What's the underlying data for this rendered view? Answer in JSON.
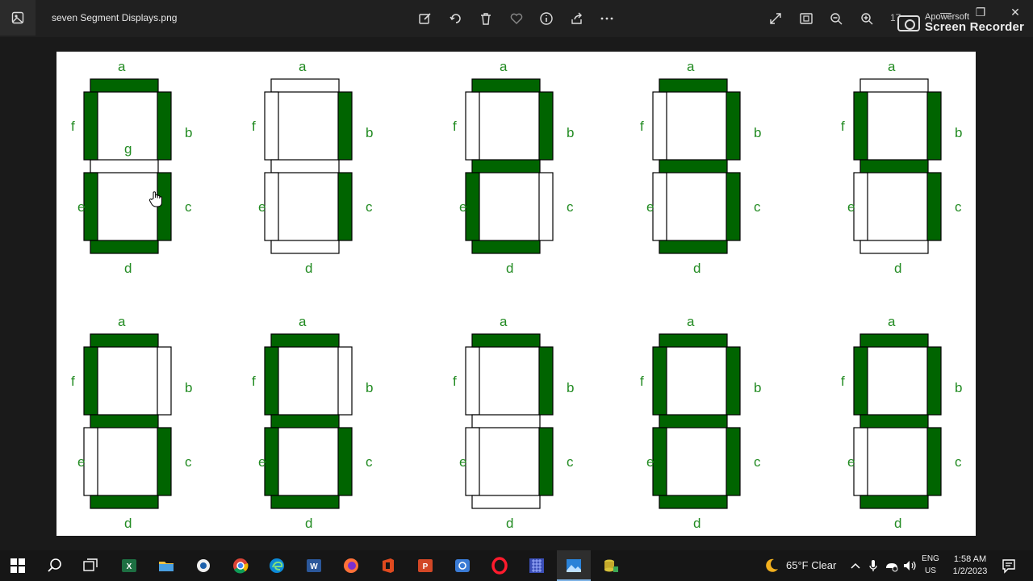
{
  "titlebar": {
    "file_name": "seven Segment Displays.png",
    "zoom_label": "17",
    "watermark_small": "Apowersoft",
    "watermark_big": "Screen Recorder",
    "toolbar_icons": [
      "edit-icon",
      "rotate-icon",
      "delete-icon",
      "favorite-icon",
      "info-icon",
      "share-icon",
      "more-icon"
    ],
    "right_icons": [
      "fullscreen-icon",
      "fit-window-icon",
      "zoom-out-icon",
      "zoom-in-icon"
    ],
    "window_controls": {
      "minimize": "—",
      "restore": "❐",
      "close": "✕"
    }
  },
  "image": {
    "segment_on_color": "#006400",
    "segment_off_color": "#ffffff",
    "segment_border_color": "#000000",
    "label_color": "#228b22",
    "digits": [
      {
        "segments": {
          "a": true,
          "b": true,
          "c": true,
          "d": true,
          "e": true,
          "f": true,
          "g": false
        },
        "show_g_label": true
      },
      {
        "segments": {
          "a": false,
          "b": true,
          "c": true,
          "d": false,
          "e": false,
          "f": false,
          "g": false
        },
        "show_g_label": false
      },
      {
        "segments": {
          "a": true,
          "b": true,
          "c": false,
          "d": true,
          "e": true,
          "f": false,
          "g": true
        },
        "show_g_label": false
      },
      {
        "segments": {
          "a": true,
          "b": true,
          "c": true,
          "d": true,
          "e": false,
          "f": false,
          "g": true
        },
        "show_g_label": false
      },
      {
        "segments": {
          "a": false,
          "b": true,
          "c": true,
          "d": false,
          "e": false,
          "f": true,
          "g": true
        },
        "show_g_label": false
      },
      {
        "segments": {
          "a": true,
          "b": false,
          "c": true,
          "d": true,
          "e": false,
          "f": true,
          "g": true
        },
        "show_g_label": false
      },
      {
        "segments": {
          "a": true,
          "b": false,
          "c": true,
          "d": true,
          "e": true,
          "f": true,
          "g": true
        },
        "show_g_label": false
      },
      {
        "segments": {
          "a": true,
          "b": true,
          "c": true,
          "d": false,
          "e": false,
          "f": false,
          "g": false
        },
        "show_g_label": false
      },
      {
        "segments": {
          "a": true,
          "b": true,
          "c": true,
          "d": true,
          "e": true,
          "f": true,
          "g": true
        },
        "show_g_label": false
      },
      {
        "segments": {
          "a": true,
          "b": true,
          "c": true,
          "d": true,
          "e": false,
          "f": true,
          "g": true
        },
        "show_g_label": false
      }
    ],
    "labels": {
      "a": "a",
      "b": "b",
      "c": "c",
      "d": "d",
      "e": "e",
      "f": "f",
      "g": "g"
    }
  },
  "taskbar": {
    "apps": [
      "windows-start-icon",
      "search-icon",
      "task-view-icon",
      "excel-icon",
      "file-explorer-icon",
      "media-player-icon",
      "chrome-icon",
      "edge-icon",
      "word-icon",
      "firefox-icon",
      "office-icon",
      "powerpoint-icon",
      "snipping-tool-icon",
      "opera-icon",
      "app-grid-icon",
      "photos-icon",
      "sql-app-icon"
    ],
    "weather": "65°F  Clear",
    "lang_top": "ENG",
    "lang_bottom": "US",
    "time": "1:58 AM",
    "date": "1/2/2023"
  }
}
